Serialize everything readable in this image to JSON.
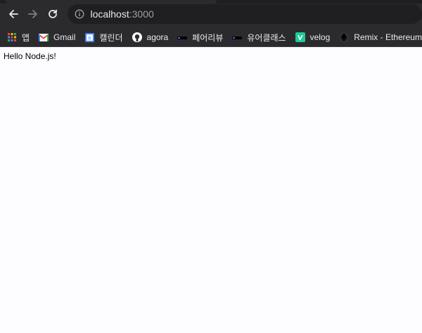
{
  "address_bar": {
    "host": "localhost",
    "port": ":3000"
  },
  "bookmarks": [
    {
      "label": "앱",
      "icon": "apps-grid-icon"
    },
    {
      "label": "Gmail",
      "icon": "gmail-icon"
    },
    {
      "label": "캘린더",
      "icon": "calendar-icon"
    },
    {
      "label": "agora",
      "icon": "github-icon"
    },
    {
      "label": "페어리뷰",
      "icon": "codestates-icon"
    },
    {
      "label": "유어클래스",
      "icon": "codestates-icon"
    },
    {
      "label": "velog",
      "icon": "velog-icon"
    },
    {
      "label": "Remix - Ethereum...",
      "icon": "ethereum-icon"
    }
  ],
  "page": {
    "body_text": "Hello Node.js!"
  },
  "colors": {
    "toolbar_bg": "#2b2b2e",
    "omnibox_bg": "#1f1f22",
    "text_light": "#e8eaed",
    "text_dim": "#9aa0a6",
    "velog_green": "#20c997"
  }
}
